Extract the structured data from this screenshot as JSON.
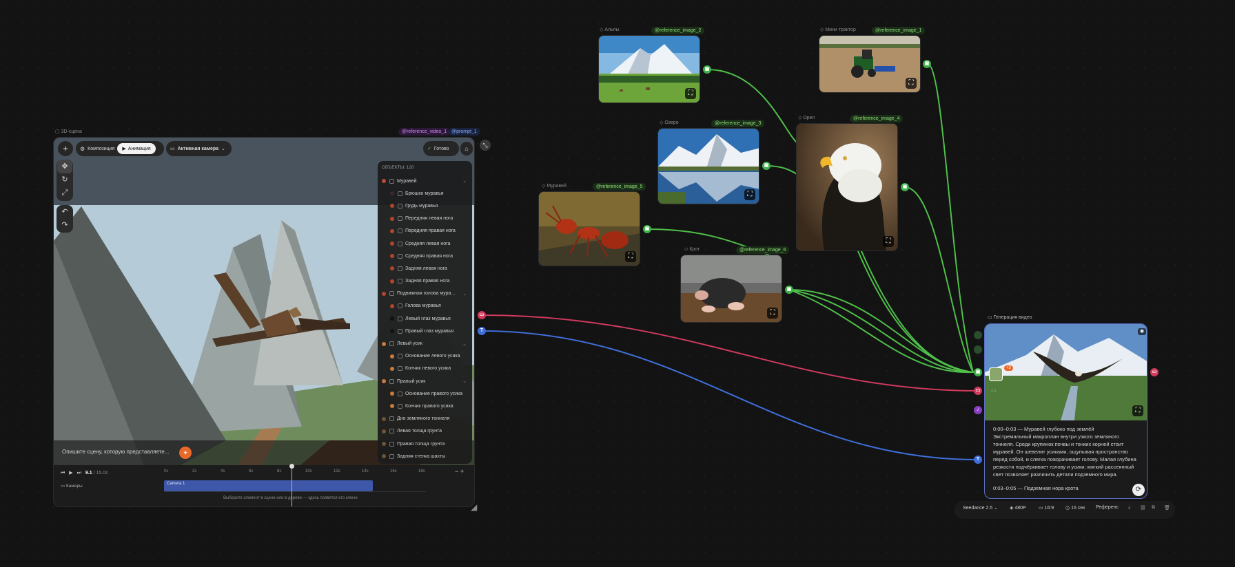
{
  "colors": {
    "green": "#3fb04a",
    "red": "#d13a5d",
    "blue": "#3f6ed8",
    "purple": "#8a3ec4",
    "accent": "#e8692a"
  },
  "scene_panel": {
    "title": "3D-сцена",
    "tag_video": "@reference_video_1",
    "tag_prompt": "@prompt_1",
    "mode_composition": "Композиция",
    "mode_animation": "Анимация",
    "camera_select": "Активная камера",
    "ready_label": "Готово",
    "objects_header": "ОБЪЕКТЫ: 120",
    "outliner": [
      {
        "label": "Муравей",
        "indent": 0,
        "color": "#c04a36",
        "chev": true
      },
      {
        "label": "Брюшко муравья",
        "indent": 1,
        "color": "#3a2a2a"
      },
      {
        "label": "Грудь муравья",
        "indent": 1,
        "color": "#b3442c"
      },
      {
        "label": "Передняя левая нога",
        "indent": 1,
        "color": "#b3442c"
      },
      {
        "label": "Передняя правая нога",
        "indent": 1,
        "color": "#b3442c"
      },
      {
        "label": "Средняя левая нога",
        "indent": 1,
        "color": "#b3442c"
      },
      {
        "label": "Средняя правая нога",
        "indent": 1,
        "color": "#b3442c"
      },
      {
        "label": "Задняя левая нога",
        "indent": 1,
        "color": "#b3442c"
      },
      {
        "label": "Задняя правая нога",
        "indent": 1,
        "color": "#b3442c"
      },
      {
        "label": "Подвижная голова мура...",
        "indent": 0,
        "color": "#b3442c",
        "chev": true
      },
      {
        "label": "Голова муравья",
        "indent": 1,
        "color": "#b3442c"
      },
      {
        "label": "Левый глаз муравья",
        "indent": 1,
        "color": "#111111"
      },
      {
        "label": "Правый глаз муравья",
        "indent": 1,
        "color": "#111111"
      },
      {
        "label": "Левый усик",
        "indent": 0,
        "color": "#c97a3c",
        "chev": true
      },
      {
        "label": "Основание левого усика",
        "indent": 1,
        "color": "#c97a3c"
      },
      {
        "label": "Кончик левого усика",
        "indent": 1,
        "color": "#c97a3c"
      },
      {
        "label": "Правый усик",
        "indent": 0,
        "color": "#c97a3c",
        "chev": true
      },
      {
        "label": "Основание правого усика",
        "indent": 1,
        "color": "#c97a3c"
      },
      {
        "label": "Кончик правого усика",
        "indent": 1,
        "color": "#c97a3c"
      },
      {
        "label": "Дно земляного тоннеля",
        "indent": 0,
        "color": "#6e5436"
      },
      {
        "label": "Левая толща грунта",
        "indent": 0,
        "color": "#6e5436"
      },
      {
        "label": "Правая толща грунта",
        "indent": 0,
        "color": "#6e5436"
      },
      {
        "label": "Задняя стенка шахты",
        "indent": 0,
        "color": "#6e5436"
      }
    ],
    "prompt_placeholder": "Опишите сцену, которую представляете...",
    "timeline": {
      "time": "9.1",
      "duration": "/ 15.0s",
      "ticks": [
        "0s",
        "2s",
        "4s",
        "6s",
        "8s",
        "10s",
        "12s",
        "14s",
        "16s",
        "18s"
      ],
      "track_label": "Камеры",
      "clip_label": "Camera 1",
      "hint": "Выберите элемент в сцене или в дереве — здесь появятся его ключи"
    }
  },
  "nodes": [
    {
      "id": "alps",
      "title": "Альпы",
      "tag": "@reference_image_2"
    },
    {
      "id": "tractor",
      "title": "Мини трактор",
      "tag": "@reference_image_1"
    },
    {
      "id": "lake",
      "title": "Озеро",
      "tag": "@reference_image_3"
    },
    {
      "id": "eagle",
      "title": "Орел",
      "tag": "@reference_image_4"
    },
    {
      "id": "ant",
      "title": "Муравей",
      "tag": "@reference_image_5"
    },
    {
      "id": "mole",
      "title": "Крот",
      "tag": "@reference_image_6"
    }
  ],
  "generation": {
    "title": "Генерация видео",
    "badge": "+3",
    "text1_time": "0:00–0:03 — Муравей глубоко под землёй",
    "text1_body": "Экстремальный макроплан внутри узкого земляного тоннеля. Среди крупинок почвы и тонких корней стоит муравей. Он шевелит усиками, ощупывая пространство перед собой, и слегка поворачивает голову. Малая глубина резкости подчёркивает голову и усики; мягкий рассеянный свет позволяет различить детали подземного мира.",
    "text2_time": "0:03–0:05 — Подземная нора крота",
    "model": "Seedance 2.5",
    "resolution": "480P",
    "aspect": "16:9",
    "duration": "15 сек",
    "mode": "Референс"
  }
}
